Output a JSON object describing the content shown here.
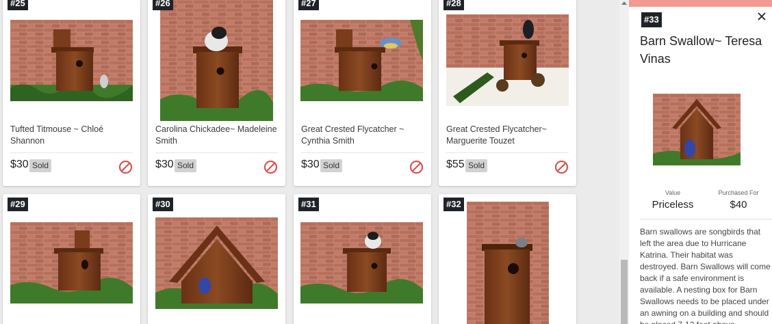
{
  "cards": [
    {
      "number": "#25",
      "title": "Tufted Titmouse ~ Chloé Shannon",
      "price": "$30",
      "status": "Sold"
    },
    {
      "number": "#26",
      "title": "Carolina Chickadee~ Madeleine Smith",
      "price": "$30",
      "status": "Sold"
    },
    {
      "number": "#27",
      "title": "Great Crested Flycatcher ~ Cynthia Smith",
      "price": "$30",
      "status": "Sold"
    },
    {
      "number": "#28",
      "title": "Great Crested Flycatcher~ Marguerite Touzet",
      "price": "$55",
      "status": "Sold"
    },
    {
      "number": "#29"
    },
    {
      "number": "#30"
    },
    {
      "number": "#31"
    },
    {
      "number": "#32"
    }
  ],
  "detail": {
    "number": "#33",
    "title": "Barn Swallow~ Teresa Vinas",
    "value_label": "Value",
    "value": "Priceless",
    "purchased_label": "Purchased For",
    "purchased": "$40",
    "description": "Barn swallows are songbirds that left the area due to Hurricane Katrina. Their habitat was destroyed. Barn Swallows will come back if a safe environment is available. A nesting box for Barn Swallows needs to be placed under an awning on a building and should be placed 7-12 feet above"
  },
  "colors": {
    "accent_bar": "#f29a92",
    "badge_bg": "#1f2328",
    "not_available_icon": "#d9534f"
  }
}
